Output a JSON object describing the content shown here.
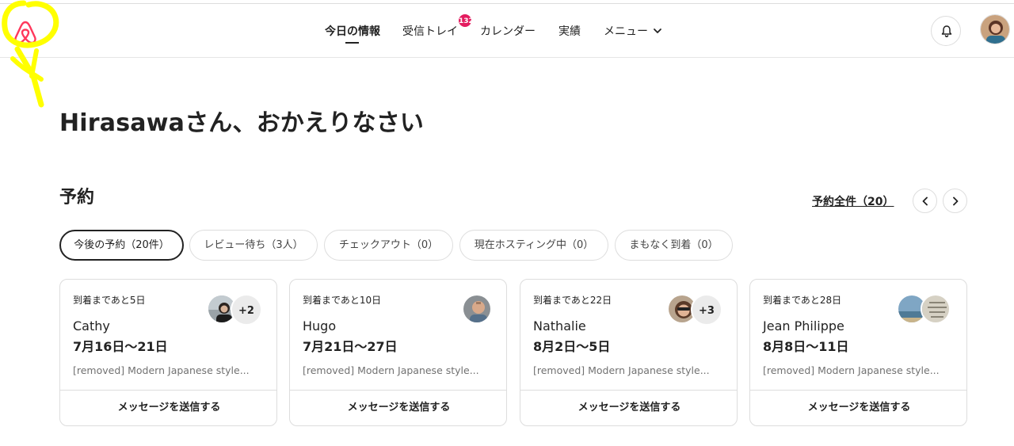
{
  "nav": {
    "items": [
      {
        "label": "今日の情報"
      },
      {
        "label": "受信トレイ"
      },
      {
        "label": "カレンダー"
      },
      {
        "label": "実績"
      },
      {
        "label": "メニュー"
      }
    ],
    "inbox_badge": "132"
  },
  "welcome": "Hirasawaさん、おかえりなさい",
  "reservations": {
    "title": "予約",
    "all_link": "予約全件（20）",
    "filters": [
      {
        "label": "今後の予約（20件）"
      },
      {
        "label": "レビュー待ち（3人）"
      },
      {
        "label": "チェックアウト（0）"
      },
      {
        "label": "現在ホスティング中（0）"
      },
      {
        "label": "まもなく到着（0）"
      }
    ],
    "cards": [
      {
        "time": "到着まであと5日",
        "name": "Cathy",
        "dates": "7月16日～21日",
        "listing": "[removed] Modern Japanese style...",
        "extra": "+2",
        "button": "メッセージを送信する"
      },
      {
        "time": "到着まであと10日",
        "name": "Hugo",
        "dates": "7月21日～27日",
        "listing": "[removed] Modern Japanese style...",
        "extra": "",
        "button": "メッセージを送信する"
      },
      {
        "time": "到着まであと22日",
        "name": "Nathalie",
        "dates": "8月2日～5日",
        "listing": "[removed] Modern Japanese style...",
        "extra": "+3",
        "button": "メッセージを送信する"
      },
      {
        "time": "到着まであと28日",
        "name": "Jean Philippe",
        "dates": "8月8日～11日",
        "listing": "[removed] Modern Japanese style...",
        "extra": "",
        "button": "メッセージを送信する"
      }
    ]
  },
  "colors": {
    "accent": "#222222",
    "badge": "#e31c5f",
    "brand": "#ff385c",
    "highlight": "#ffff00"
  },
  "icons": [
    "airbnb-logo-icon",
    "chevron-down-icon",
    "bell-icon",
    "chevron-left-icon",
    "chevron-right-icon"
  ]
}
